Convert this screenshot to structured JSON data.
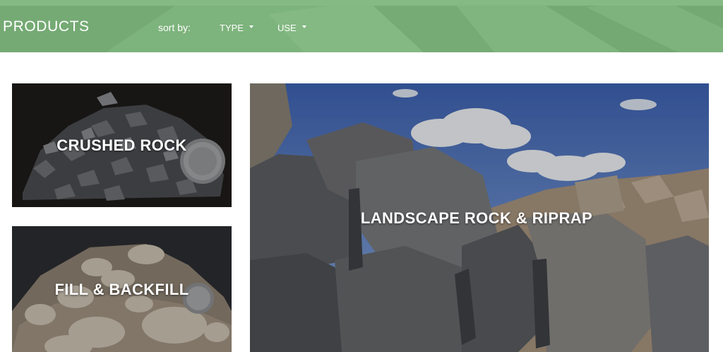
{
  "header": {
    "title": "PRODUCTS",
    "sort_label": "sort by:",
    "sort_type": "TYPE",
    "sort_use": "USE"
  },
  "tiles": {
    "crushed_rock": "CRUSHED ROCK",
    "fill_backfill": "FILL & BACKFILL",
    "landscape": "LANDSCAPE ROCK & RIPRAP"
  },
  "colors": {
    "header_green": "#79ae78",
    "label_text": "#ffffff"
  },
  "icons": {
    "dropdown": "caret-down-icon"
  }
}
